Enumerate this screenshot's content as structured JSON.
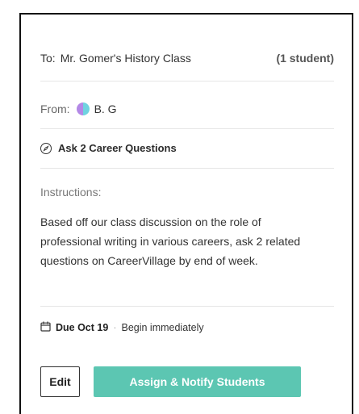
{
  "assignment": {
    "to_label": "To:",
    "to_value": "Mr. Gomer's History Class",
    "to_count": "(1 student)",
    "from_label": "From:",
    "from_name": "B. G",
    "avatar_colors": [
      "#b388e6",
      "#6fd3e0"
    ],
    "title": "Ask 2 Career Questions",
    "title_icon": "compass-icon",
    "instructions_label": "Instructions:",
    "instructions_text": "Based off our class discussion on the role of professional writing in various careers, ask 2 related questions on CareerVillage by end of week.",
    "due_icon": "calendar-icon",
    "due_label": "Due Oct 19",
    "separator": "·",
    "begin_label": "Begin immediately"
  },
  "actions": {
    "edit_label": "Edit",
    "assign_label": "Assign & Notify Students",
    "assign_color": "#5cc6b2"
  }
}
